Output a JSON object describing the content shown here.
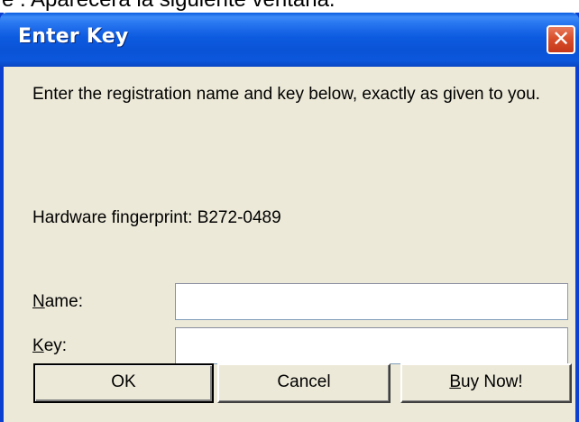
{
  "caption": "e . Aparecerá la siguiente ventana.",
  "window": {
    "title": "Enter Key",
    "close_glyph": "✕"
  },
  "dialog": {
    "instructions": "Enter the registration name and key below, exactly as given to you.",
    "fingerprint": "Hardware fingerprint: B272-0489",
    "name_label_accel": "N",
    "name_label_rest": "ame:",
    "name_value": "",
    "key_label_accel": "K",
    "key_label_rest": "ey:",
    "key_value": ""
  },
  "buttons": {
    "ok": "OK",
    "cancel": "Cancel",
    "buy_accel": "B",
    "buy_rest": "uy Now!"
  },
  "colors": {
    "titlebar": "#0a53d6",
    "close_button": "#d94f2b",
    "dialog_face": "#ece9d8"
  }
}
